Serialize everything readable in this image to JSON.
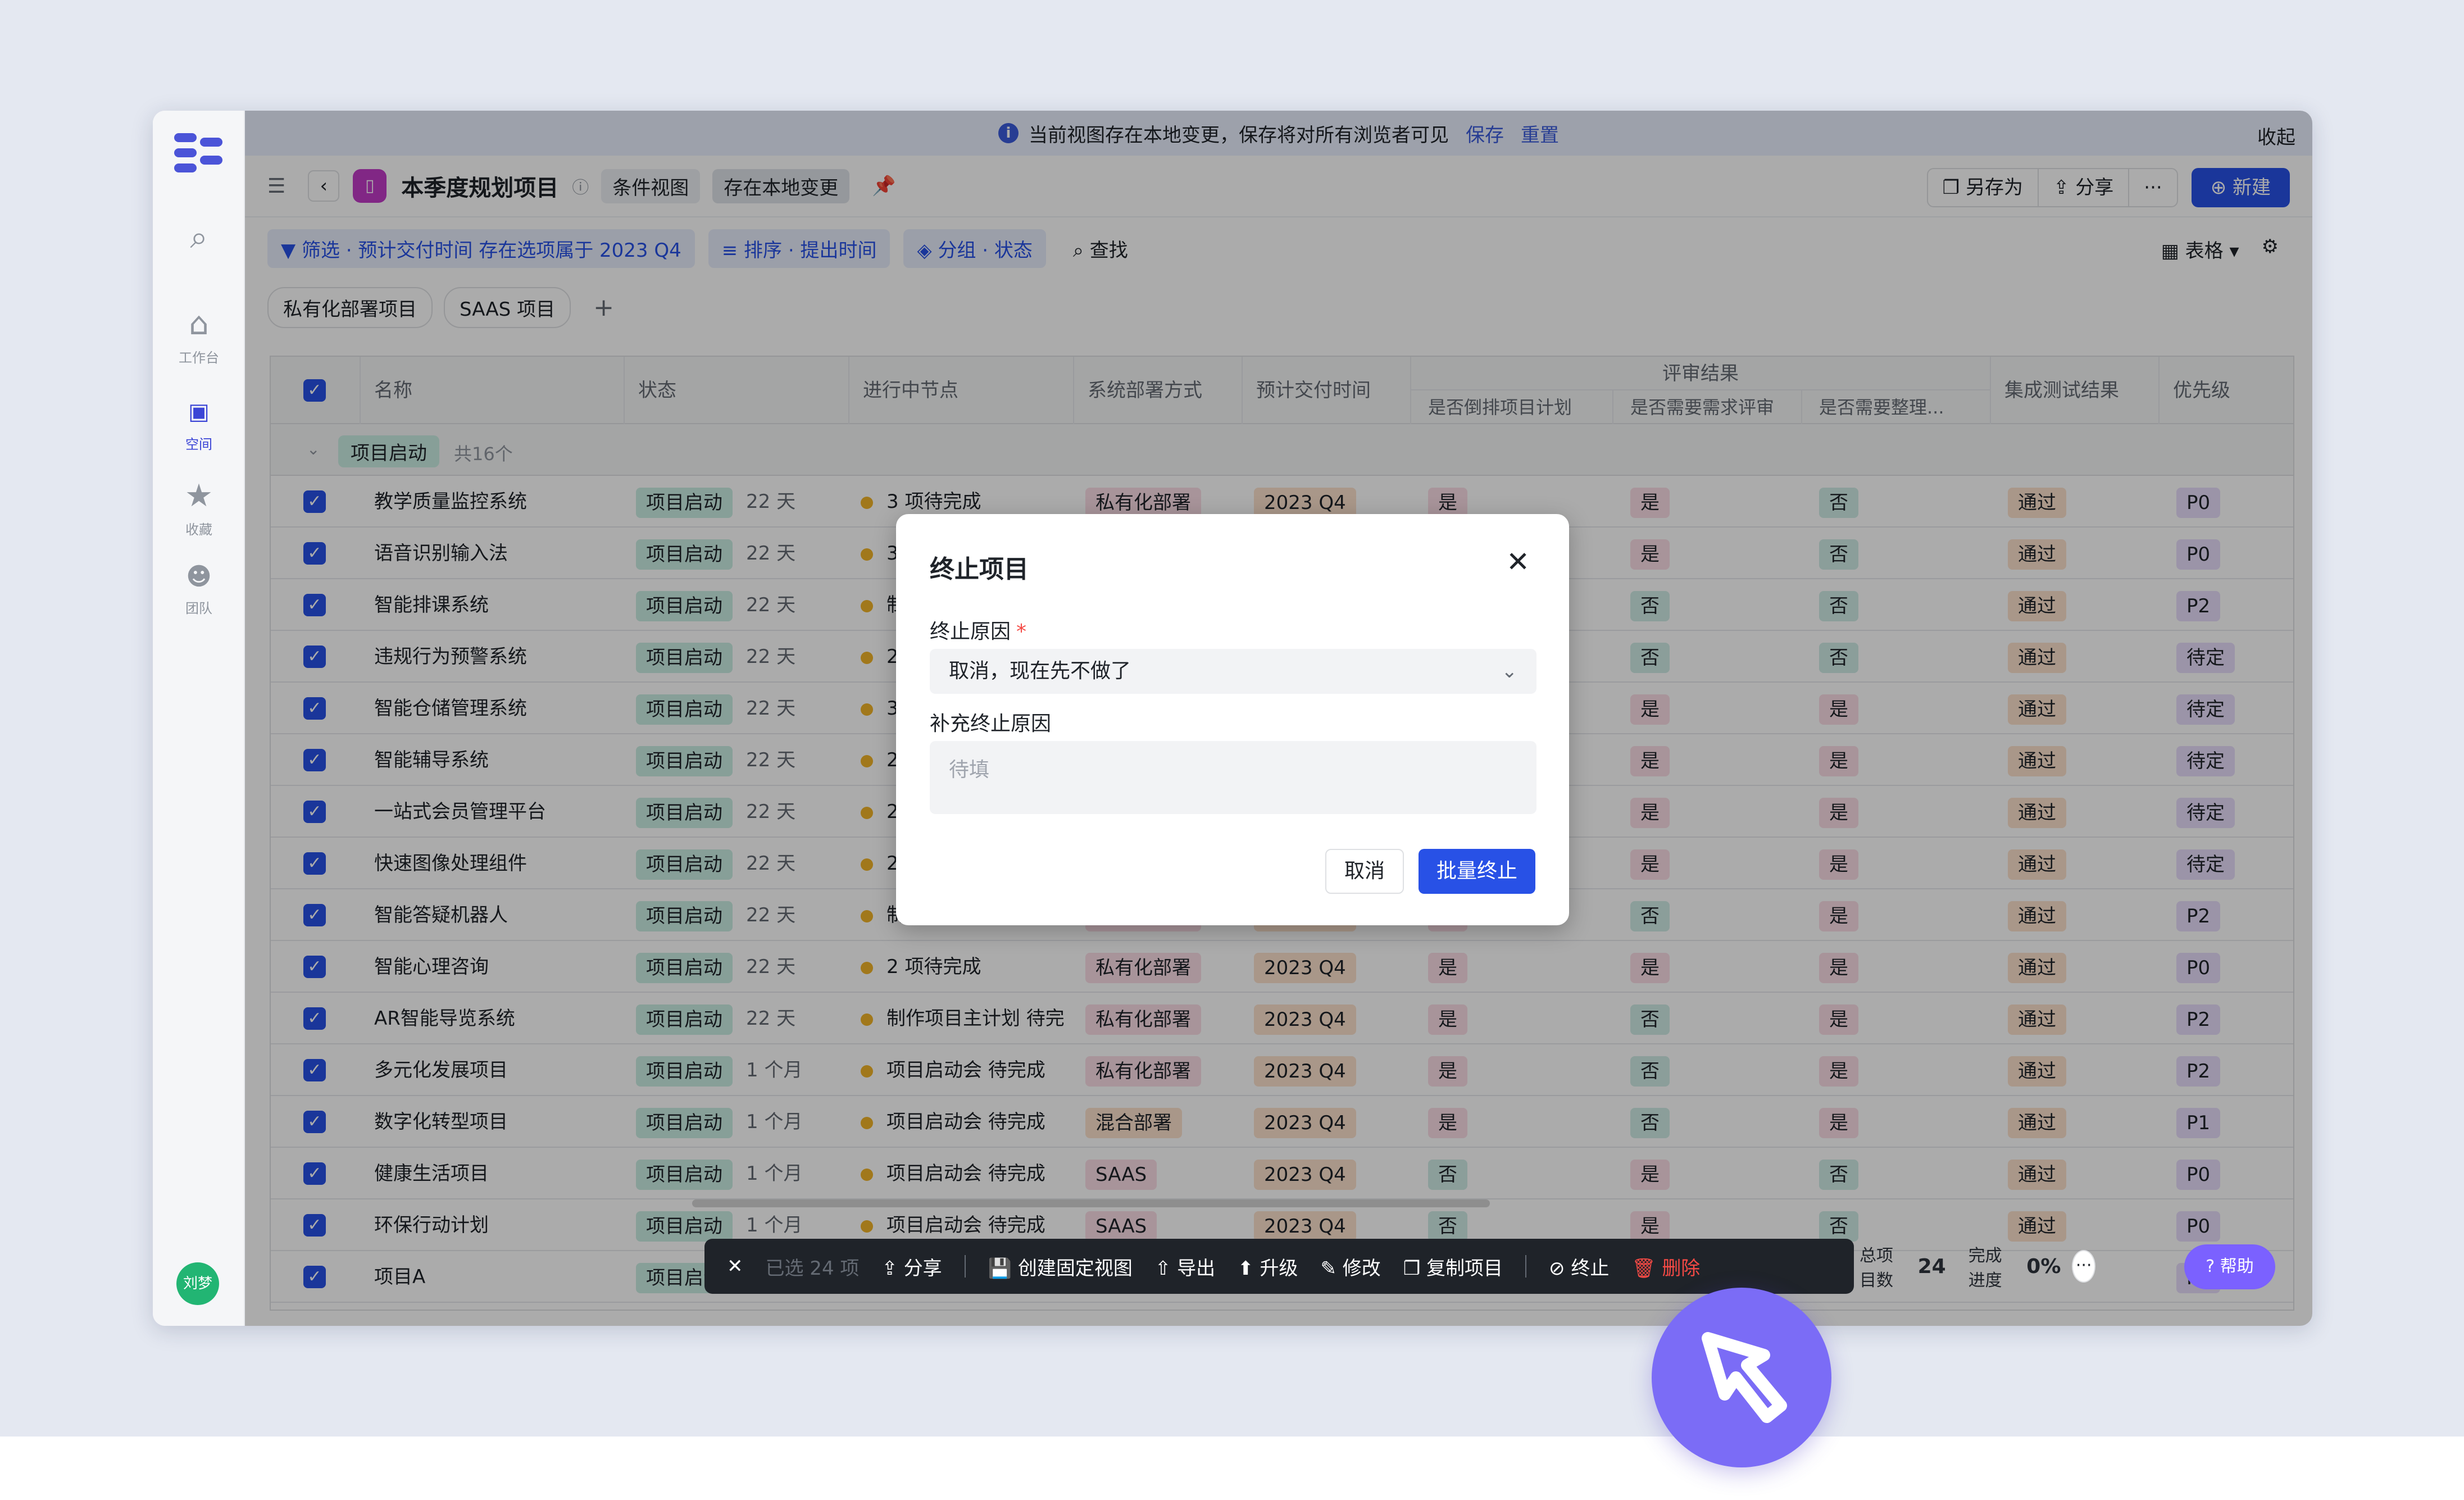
{
  "banner": {
    "message": "当前视图存在本地变更，保存将对所有浏览者可见",
    "save": "保存",
    "reset": "重置",
    "collapse": "收起"
  },
  "sidebar": {
    "items": [
      {
        "label": "工作台"
      },
      {
        "label": "空间"
      },
      {
        "label": "收藏"
      },
      {
        "label": "团队"
      }
    ],
    "avatar": "刘梦"
  },
  "header": {
    "title": "本季度规划项目",
    "tag1": "条件视图",
    "tag2": "存在本地变更",
    "save_as": "另存为",
    "share": "分享",
    "new": "新建"
  },
  "filters": {
    "filter": "筛选 · 预计交付时间 存在选项属于 2023 Q4",
    "sort": "排序 · 提出时间",
    "group": "分组 · 状态",
    "find": "查找",
    "view": "表格"
  },
  "tabs": [
    "私有化部署项目",
    "SAAS 项目"
  ],
  "columns": {
    "name": "名称",
    "status": "状态",
    "node": "进行中节点",
    "deploy": "系统部署方式",
    "delivery": "预计交付时间",
    "review": "评审结果",
    "review1": "是否倒排项目计划",
    "review2": "是否需要需求评审",
    "review3": "是否需要整理...",
    "test": "集成测试结果",
    "priority": "优先级"
  },
  "group": {
    "label": "项目启动",
    "count": "共16个"
  },
  "rows": [
    {
      "name": "教学质量监控系统",
      "status": "项目启动",
      "days": "22 天",
      "node": "3 项待完成",
      "deploy": "私有化部署",
      "delivery": "2023 Q4",
      "r1": "是",
      "r2": "是",
      "r3": "否",
      "test": "通过",
      "priority": "P0"
    },
    {
      "name": "语音识别输入法",
      "status": "项目启动",
      "days": "22 天",
      "node": "3",
      "deploy": "",
      "delivery": "",
      "r1": "",
      "r2": "是",
      "r3": "否",
      "test": "通过",
      "priority": "P0"
    },
    {
      "name": "智能排课系统",
      "status": "项目启动",
      "days": "22 天",
      "node": "制",
      "deploy": "",
      "delivery": "",
      "r1": "",
      "r2": "否",
      "r3": "否",
      "test": "通过",
      "priority": "P2"
    },
    {
      "name": "违规行为预警系统",
      "status": "项目启动",
      "days": "22 天",
      "node": "2",
      "deploy": "",
      "delivery": "",
      "r1": "",
      "r2": "否",
      "r3": "否",
      "test": "通过",
      "priority": "待定"
    },
    {
      "name": "智能仓储管理系统",
      "status": "项目启动",
      "days": "22 天",
      "node": "3",
      "deploy": "",
      "delivery": "",
      "r1": "",
      "r2": "是",
      "r3": "是",
      "test": "通过",
      "priority": "待定"
    },
    {
      "name": "智能辅导系统",
      "status": "项目启动",
      "days": "22 天",
      "node": "2",
      "deploy": "",
      "delivery": "",
      "r1": "",
      "r2": "是",
      "r3": "是",
      "test": "通过",
      "priority": "待定"
    },
    {
      "name": "一站式会员管理平台",
      "status": "项目启动",
      "days": "22 天",
      "node": "2",
      "deploy": "",
      "delivery": "",
      "r1": "",
      "r2": "是",
      "r3": "是",
      "test": "通过",
      "priority": "待定"
    },
    {
      "name": "快速图像处理组件",
      "status": "项目启动",
      "days": "22 天",
      "node": "2",
      "deploy": "",
      "delivery": "",
      "r1": "",
      "r2": "是",
      "r3": "是",
      "test": "通过",
      "priority": "待定"
    },
    {
      "name": "智能答疑机器人",
      "status": "项目启动",
      "days": "22 天",
      "node": "制作项目主计划 待完",
      "deploy": "私有化部署",
      "delivery": "2023 Q4",
      "r1": "是",
      "r2": "否",
      "r3": "是",
      "test": "通过",
      "priority": "P2"
    },
    {
      "name": "智能心理咨询",
      "status": "项目启动",
      "days": "22 天",
      "node": "2 项待完成",
      "deploy": "私有化部署",
      "delivery": "2023 Q4",
      "r1": "是",
      "r2": "是",
      "r3": "是",
      "test": "通过",
      "priority": "P0"
    },
    {
      "name": "AR智能导览系统",
      "status": "项目启动",
      "days": "22 天",
      "node": "制作项目主计划 待完",
      "deploy": "私有化部署",
      "delivery": "2023 Q4",
      "r1": "是",
      "r2": "否",
      "r3": "是",
      "test": "通过",
      "priority": "P2"
    },
    {
      "name": "多元化发展项目",
      "status": "项目启动",
      "days": "1 个月",
      "node": "项目启动会 待完成",
      "deploy": "私有化部署",
      "delivery": "2023 Q4",
      "r1": "是",
      "r2": "否",
      "r3": "是",
      "test": "通过",
      "priority": "P2"
    },
    {
      "name": "数字化转型项目",
      "status": "项目启动",
      "days": "1 个月",
      "node": "项目启动会 待完成",
      "deploy": "混合部署",
      "delivery": "2023 Q4",
      "r1": "是",
      "r2": "否",
      "r3": "是",
      "test": "通过",
      "priority": "P1"
    },
    {
      "name": "健康生活项目",
      "status": "项目启动",
      "days": "1 个月",
      "node": "项目启动会 待完成",
      "deploy": "SAAS",
      "delivery": "2023 Q4",
      "r1": "否",
      "r2": "是",
      "r3": "否",
      "test": "通过",
      "priority": "P0"
    },
    {
      "name": "环保行动计划",
      "status": "项目启动",
      "days": "1 个月",
      "node": "项目启动会 待完成",
      "deploy": "SAAS",
      "delivery": "2023 Q4",
      "r1": "否",
      "r2": "是",
      "r3": "否",
      "test": "通过",
      "priority": "P0"
    },
    {
      "name": "项目A",
      "status": "项目启动",
      "days": "",
      "node": "",
      "deploy": "",
      "delivery": "",
      "r1": "",
      "r2": "",
      "r3": "",
      "test": "",
      "priority": "P1"
    }
  ],
  "modal": {
    "title": "终止项目",
    "reason_label": "终止原因",
    "required": "*",
    "reason_value": "取消，现在先不做了",
    "extra_label": "补充终止原因",
    "extra_placeholder": "待填",
    "cancel": "取消",
    "confirm": "批量终止"
  },
  "actionbar": {
    "selected": "已选 24 项",
    "share": "分享",
    "create_view": "创建固定视图",
    "export": "导出",
    "upgrade": "升级",
    "edit": "修改",
    "copy": "复制项目",
    "terminate": "终止",
    "delete": "删除"
  },
  "stats": {
    "total_label": "总项目数",
    "total": "24",
    "progress_label": "完成进度",
    "progress": "0%"
  },
  "help": "帮助"
}
